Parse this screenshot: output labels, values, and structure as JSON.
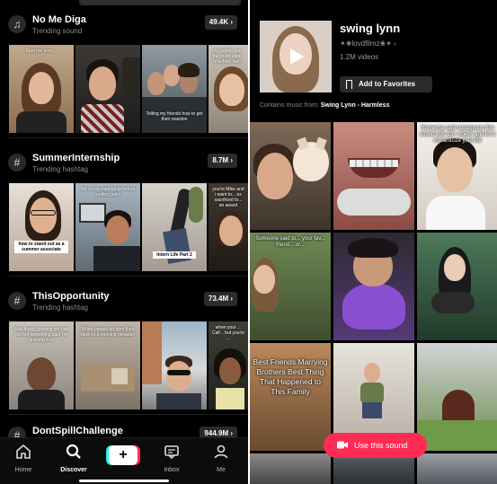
{
  "left": {
    "sections": [
      {
        "icon": "music-note-icon",
        "title": "No Me Diga",
        "subtitle": "Trending sound",
        "count": "49.4K",
        "captions": [
          "Spot me icon ...",
          "",
          "",
          "Telling my friends how to get their reaction",
          "my bestie, gra... the room after... to school last..."
        ]
      },
      {
        "icon": "hashtag-icon",
        "title": "SummerInternship",
        "subtitle": "Trending hashtag",
        "count": "8.7M",
        "captions": [
          "how to stand out as a summer associate",
          "Me on my internship before getting paid",
          "",
          "Intern Life Part 2",
          "you're Mike and i want to... ex sacrificed to... an award"
        ]
      },
      {
        "icon": "hashtag-icon",
        "title": "ThisOpportunity",
        "subtitle": "Trending hashtag",
        "count": "73.4M",
        "captions": [
          "Was finally growing my hair out but something said I'm shaving it to",
          "When people go from their desk to a meeting because",
          "",
          "when your ... Call .. but you're ..."
        ]
      },
      {
        "icon": "hashtag-icon",
        "title": "DontSpillChallenge",
        "subtitle": "",
        "count": "944.9M",
        "captions": []
      }
    ],
    "nav": [
      {
        "icon": "home-icon",
        "label": "Home"
      },
      {
        "icon": "search-icon",
        "label": "Discover"
      },
      {
        "icon": "create-plus-icon",
        "label": "+"
      },
      {
        "icon": "inbox-icon",
        "label": "Inbox"
      },
      {
        "icon": "profile-icon",
        "label": "Me"
      }
    ]
  },
  "right": {
    "title": "swing lynn",
    "author": "✶❀lovdfilmz❀✶ ›",
    "videos": "1.2M videos",
    "favorites_label": "Add to Favorites",
    "contains_prefix": "Contains music from:",
    "contains_track": "Swing Lynn - Harmless",
    "tile_texts": [
      "Best Friends Marrying Brothers Best Thing That Happened to This Family",
      "Someone said outrageous this sound with 10+ videos and let it romanticize your life",
      "Someone said to... your fav... friend... or..."
    ],
    "use_sound_label": "Use this sound",
    "accent_color": "#fe2c55"
  }
}
